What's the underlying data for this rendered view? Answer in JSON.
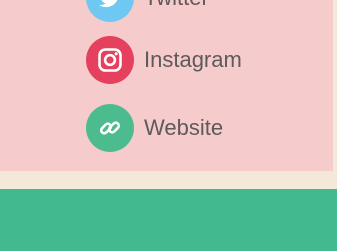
{
  "links": [
    {
      "label": "Twitter",
      "icon": "twitter-icon",
      "color": "#6fc8f2"
    },
    {
      "label": "Instagram",
      "icon": "instagram-icon",
      "color": "#e5405e"
    },
    {
      "label": "Website",
      "icon": "link-icon",
      "color": "#4cbc8e"
    }
  ],
  "colors": {
    "panel": "#f6cbcc",
    "page_background": "#f4e9d9",
    "footer": "#43b990",
    "label_text": "#5f5a5a"
  }
}
